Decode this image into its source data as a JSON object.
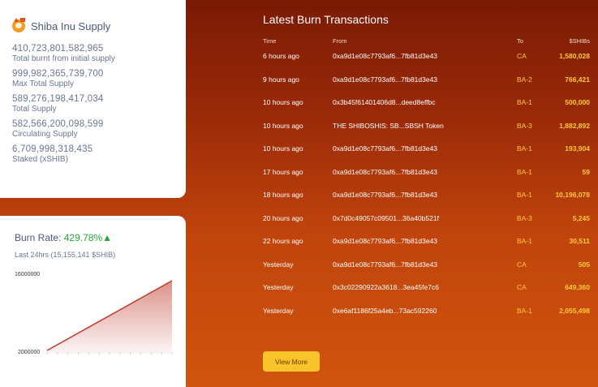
{
  "supply": {
    "title": "Shiba Inu Supply",
    "icon": "shiba-inu-icon",
    "stats": [
      {
        "value": "410,723,801,582,965",
        "label": "Total burnt from initial supply"
      },
      {
        "value": "999,982,365,739,700",
        "label": "Max Total Supply"
      },
      {
        "value": "589,276,198,417,034",
        "label": "Total Supply"
      },
      {
        "value": "582,566,200,098,599",
        "label": "Circulating Supply"
      },
      {
        "value": "6,709,998,318,435",
        "label": "Staked (xSHIB)"
      }
    ]
  },
  "burn": {
    "label": "Burn Rate:",
    "percent": "429.78%",
    "arrow": "▲",
    "sub": "Last 24hrs (15,155,141 $SHIB)",
    "chart_top_label": "16000000",
    "chart_bottom_label": "2000000"
  },
  "chart_data": {
    "type": "area",
    "title": "",
    "ylim": [
      2000000,
      16000000
    ],
    "x": [
      0,
      1
    ],
    "series": [
      {
        "values": [
          2000000,
          16000000
        ]
      }
    ],
    "color": "#c0392b"
  },
  "transactions": {
    "title": "Latest Burn Transactions",
    "headers": {
      "time": "Time",
      "from": "From",
      "to": "To",
      "amount": "$SHIBs"
    },
    "rows": [
      {
        "time": "6 hours ago",
        "from": "0xa9d1e08c7793af6...7fb81d3e43",
        "to": "CA",
        "amount": "1,580,028"
      },
      {
        "time": "9 hours ago",
        "from": "0xa9d1e08c7793af6...7fb81d3e43",
        "to": "BA-2",
        "amount": "766,421"
      },
      {
        "time": "10 hours ago",
        "from": "0x3b45f61401406d8...deed8effbc",
        "to": "BA-1",
        "amount": "500,000"
      },
      {
        "time": "10 hours ago",
        "from": "THE SHIBOSHIS: SB...SBSH Token",
        "to": "BA-3",
        "amount": "1,882,892"
      },
      {
        "time": "10 hours ago",
        "from": "0xa9d1e08c7793af6...7fb81d3e43",
        "to": "BA-1",
        "amount": "193,904"
      },
      {
        "time": "17 hours ago",
        "from": "0xa9d1e08c7793af6...7fb81d3e43",
        "to": "BA-1",
        "amount": "59"
      },
      {
        "time": "18 hours ago",
        "from": "0xa9d1e08c7793af6...7fb81d3e43",
        "to": "BA-1",
        "amount": "10,196,078"
      },
      {
        "time": "20 hours ago",
        "from": "0x7d0c49057c09501...36a40b521f",
        "to": "BA-3",
        "amount": "5,245"
      },
      {
        "time": "22 hours ago",
        "from": "0xa9d1e08c7793af6...7fb81d3e43",
        "to": "BA-1",
        "amount": "30,511"
      },
      {
        "time": "Yesterday",
        "from": "0xa9d1e08c7793af6...7fb81d3e43",
        "to": "CA",
        "amount": "505"
      },
      {
        "time": "Yesterday",
        "from": "0x3c02290922a3618...3ea45fe7c6",
        "to": "CA",
        "amount": "649,360"
      },
      {
        "time": "Yesterday",
        "from": "0xe6af1186f25a4eb...73ac592260",
        "to": "BA-1",
        "amount": "2,055,498"
      }
    ],
    "view_more": "View More"
  },
  "colors": {
    "accent": "#f9c42b",
    "positive": "#2aa43a",
    "chart_line": "#c0392b"
  }
}
